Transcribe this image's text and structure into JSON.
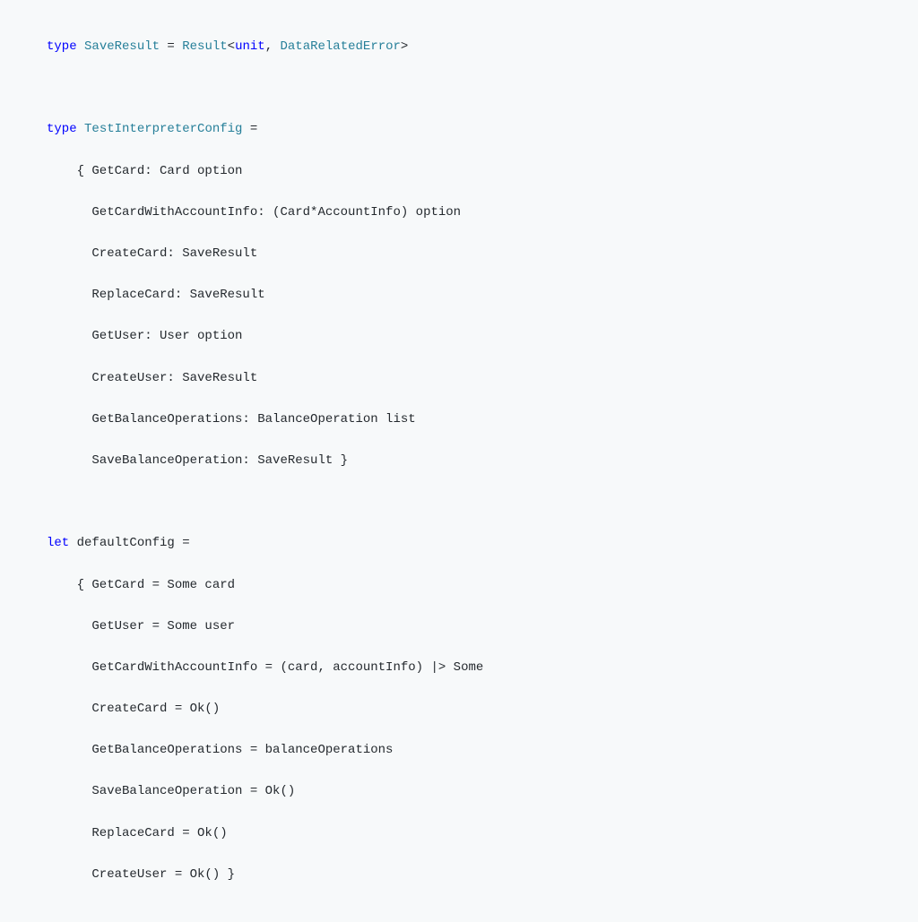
{
  "code": {
    "l1_kw1": "type",
    "l1_name": "SaveResult",
    "l1_eq": " = ",
    "l1_result": "Result",
    "l1_open": "<",
    "l1_unit": "unit",
    "l1_comma": ", ",
    "l1_err": "DataRelatedError",
    "l1_close": ">",
    "l3_kw1": "type",
    "l3_name": "TestInterpreterConfig",
    "l3_eq": " =",
    "l4": "    { GetCard: Card option",
    "l5": "      GetCardWithAccountInfo: (Card*AccountInfo) option",
    "l6": "      CreateCard: SaveResult",
    "l7": "      ReplaceCard: SaveResult",
    "l8": "      GetUser: User option",
    "l9": "      CreateUser: SaveResult",
    "l10": "      GetBalanceOperations: BalanceOperation list",
    "l11": "      SaveBalanceOperation: SaveResult }",
    "l13_kw": "let",
    "l13_name": " defaultConfig =",
    "l14": "    { GetCard = Some card",
    "l15": "      GetUser = Some user",
    "l16": "      GetCardWithAccountInfo = (card, accountInfo) |> Some",
    "l17": "      CreateCard = Ok()",
    "l18": "      GetBalanceOperations = balanceOperations",
    "l19": "      SaveBalanceOperation = Ok()",
    "l20": "      ReplaceCard = Ok()",
    "l21": "      CreateUser = Ok() }"
  }
}
